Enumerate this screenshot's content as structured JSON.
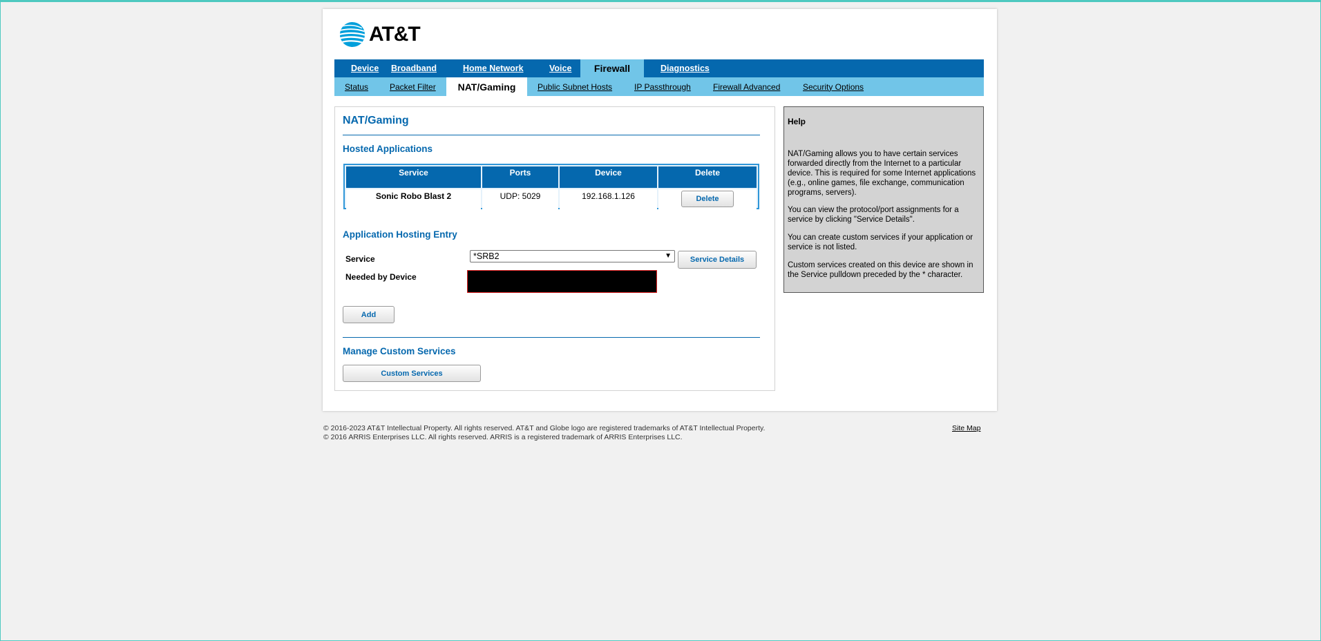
{
  "brand": {
    "name": "AT&T"
  },
  "primary_tabs": [
    {
      "label": "Device"
    },
    {
      "label": "Broadband"
    },
    {
      "label": "Home Network"
    },
    {
      "label": "Voice"
    },
    {
      "label": "Firewall"
    },
    {
      "label": "Diagnostics"
    }
  ],
  "secondary_tabs": [
    {
      "label": "Status"
    },
    {
      "label": "Packet Filter"
    },
    {
      "label": "NAT/Gaming"
    },
    {
      "label": "Public Subnet Hosts"
    },
    {
      "label": "IP Passthrough"
    },
    {
      "label": "Firewall Advanced"
    },
    {
      "label": "Security Options"
    }
  ],
  "main": {
    "title": "NAT/Gaming",
    "hosted": {
      "title": "Hosted Applications",
      "headers": [
        "Service",
        "Ports",
        "Device",
        "Delete"
      ],
      "rows": [
        {
          "service": "Sonic Robo Blast 2",
          "ports": "UDP: 5029",
          "device": "192.168.1.126",
          "delete_label": "Delete"
        }
      ]
    },
    "entry": {
      "title": "Application Hosting Entry",
      "service_label": "Service",
      "service_value": "*SRB2",
      "service_details_label": "Service Details",
      "device_label": "Needed by Device",
      "add_label": "Add"
    },
    "custom": {
      "title": "Manage Custom Services",
      "button_label": "Custom Services"
    }
  },
  "help": {
    "title": "Help",
    "paragraphs": [
      "NAT/Gaming allows you to have certain services forwarded directly from the Internet to a particular device. This is required for some Internet applications (e.g., online games, file exchange, communication programs, servers).",
      "You can view the protocol/port assignments for a service by clicking \"Service Details\".",
      "You can create custom services if your application or service is not listed.",
      "Custom services created on this device are shown in the Service pulldown preceded by the * character."
    ]
  },
  "footer": {
    "line1": "© 2016-2023 AT&T Intellectual Property. All rights reserved. AT&T and Globe logo are registered trademarks of AT&T Intellectual Property.",
    "line2": "© 2016 ARRIS Enterprises LLC. All rights reserved. ARRIS is a registered trademark of ARRIS Enterprises LLC.",
    "sitemap": "Site Map"
  },
  "colors": {
    "primary_blue": "#0568ae",
    "light_blue": "#71c5e8",
    "background": "#f1f1f1",
    "help_bg": "#d3d3d3",
    "redacted": "#000000",
    "redacted_border": "#e02020"
  }
}
